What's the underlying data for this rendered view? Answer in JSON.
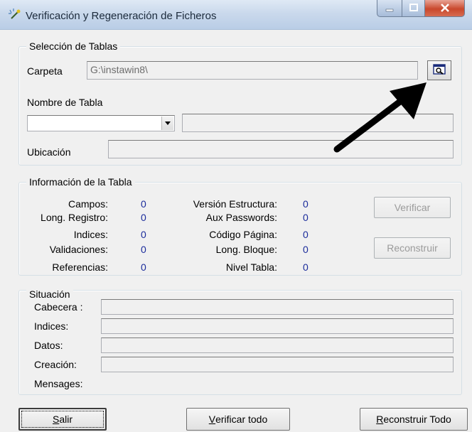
{
  "window": {
    "title": "Verificación y Regeneración de Ficheros",
    "icons": {
      "app": "magic-wand-icon",
      "minimize": "minimize-icon",
      "maximize": "maximize-icon",
      "close": "close-icon"
    }
  },
  "seleccion": {
    "legend": "Selección de Tablas",
    "carpeta_label": "Carpeta",
    "carpeta_value": "G:\\instawin8\\",
    "browse_icon": "search-folder-icon",
    "nombre_label": "Nombre de Tabla",
    "nombre_value": "",
    "nombre_desc": "",
    "ubicacion_label": "Ubicación",
    "ubicacion_value": ""
  },
  "info": {
    "legend": "Información de la Tabla",
    "left": [
      {
        "label": "Campos:",
        "value": "0"
      },
      {
        "label": "Long. Registro:",
        "value": "0"
      },
      {
        "label": "Indices:",
        "value": "0"
      },
      {
        "label": "Validaciones:",
        "value": "0"
      },
      {
        "label": "Referencias:",
        "value": "0"
      }
    ],
    "right": [
      {
        "label": "Versión Estructura:",
        "value": "0"
      },
      {
        "label": "Aux Passwords:",
        "value": "0"
      },
      {
        "label": "Código Página:",
        "value": "0"
      },
      {
        "label": "Long. Bloque:",
        "value": "0"
      },
      {
        "label": "Nivel Tabla:",
        "value": "0"
      }
    ],
    "verificar_label": "Verificar",
    "reconstruir_label": "Reconstruir"
  },
  "situacion": {
    "legend": "Situación",
    "rows": [
      {
        "label": "Cabecera :",
        "value": ""
      },
      {
        "label": "Indices:",
        "value": ""
      },
      {
        "label": "Datos:",
        "value": ""
      },
      {
        "label": "Creación:",
        "value": ""
      }
    ],
    "mensajes_label": "Mensages:"
  },
  "footer": {
    "salir_first": "S",
    "salir_rest": "alir",
    "verificar_todo_first": "V",
    "verificar_todo_rest": "erificar todo",
    "reconstruir_todo_first": "R",
    "reconstruir_todo_rest": "econstruir Todo"
  },
  "annotation": {
    "arrow_icon": "pointer-arrow-icon"
  }
}
